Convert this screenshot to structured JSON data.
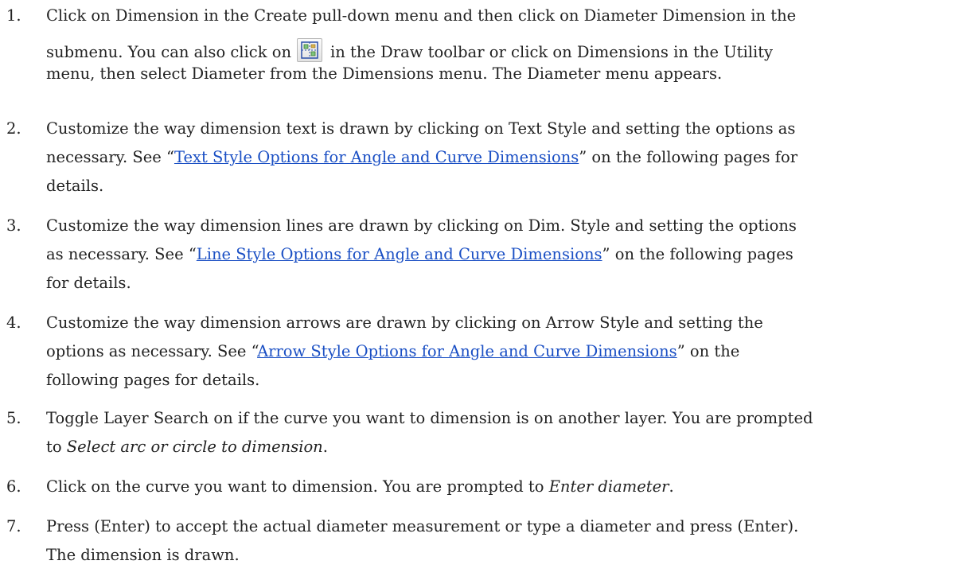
{
  "steps": [
    {
      "number": "1.",
      "line1": "Click on Dimension in the Create pull-down menu and then click on Diameter Dimension in the",
      "line2_before": "submenu. You can also click on",
      "icon": "diameter-dimension-icon",
      "line2_after": "in the Draw toolbar or click on Dimensions in the Utility",
      "line3": "menu, then select Diameter from the Dimensions menu. The Diameter menu appears."
    },
    {
      "number": "2.",
      "line1": "Customize the way dimension text is drawn by clicking on Text Style and setting the options as",
      "line2_before": "necessary. See “",
      "link": "Text Style Options for Angle and Curve Dimensions",
      "line2_after": "” on the following pages for",
      "line3": "details."
    },
    {
      "number": "3.",
      "line1": "Customize the way dimension lines are drawn by clicking on Dim. Style and setting the options",
      "line2_before": "as necessary. See “",
      "link": "Line Style Options for Angle and Curve Dimensions",
      "line2_after": "” on the following pages",
      "line3": "for details."
    },
    {
      "number": "4.",
      "line1": "Customize the way dimension arrows are drawn by clicking on Arrow Style and setting the",
      "line2_before": "options as necessary. See “",
      "link": "Arrow Style Options for Angle and Curve Dimensions",
      "line2_after": "” on the",
      "line3": "following pages for details."
    },
    {
      "number": "5.",
      "line1": "Toggle Layer Search on if the curve you want to dimension is on another layer. You are prompted",
      "line2_before": "to ",
      "prompt": "Select arc or circle to dimension",
      "line2_after": "."
    },
    {
      "number": "6.",
      "line1_before": "Click on the curve you want to dimension. You are prompted to ",
      "prompt": "Enter diameter",
      "line1_after": "."
    },
    {
      "number": "7.",
      "line1": "Press (Enter) to accept the actual diameter measurement or type a diameter and press (Enter).",
      "line2": "The dimension is drawn."
    }
  ],
  "colors": {
    "text": "#222222",
    "link": "#1a4fc4"
  }
}
